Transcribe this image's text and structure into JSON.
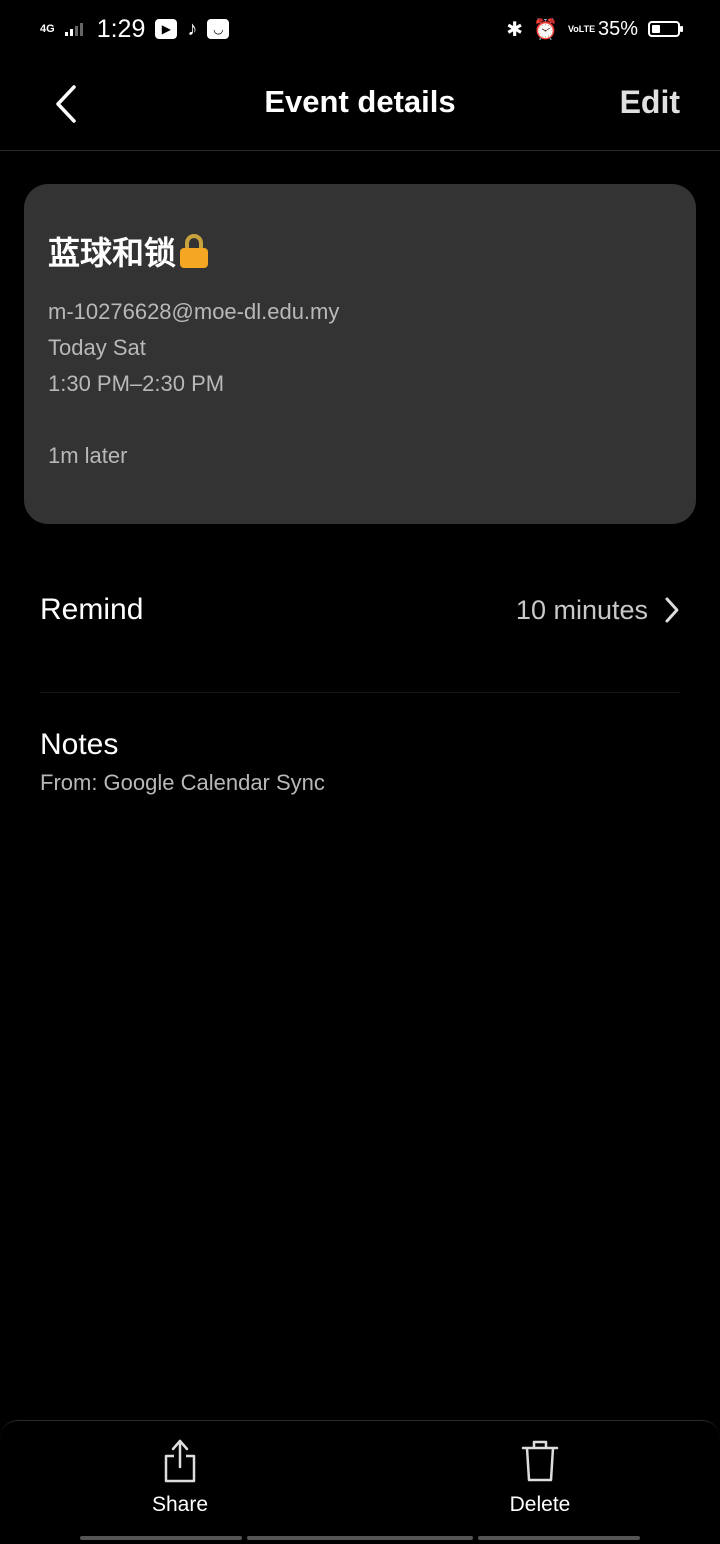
{
  "status_bar": {
    "network": "4G",
    "time": "1:29",
    "battery_percent": "35%",
    "battery_level": 0.35,
    "volte": "VoLTE"
  },
  "header": {
    "title": "Event details",
    "edit_label": "Edit"
  },
  "event": {
    "title": "蓝球和锁",
    "account": "m-10276628@moe-dl.edu.my",
    "date": "Today Sat",
    "time_range": "1:30 PM–2:30 PM",
    "countdown": "1m later"
  },
  "remind": {
    "label": "Remind",
    "value": "10 minutes"
  },
  "notes": {
    "label": "Notes",
    "text": "From: Google Calendar Sync"
  },
  "bottom_bar": {
    "share_label": "Share",
    "delete_label": "Delete"
  },
  "colors": {
    "background": "#000000",
    "card": "#333333",
    "secondary_text": "#b8b8b8",
    "lock_body": "#f5a623"
  }
}
